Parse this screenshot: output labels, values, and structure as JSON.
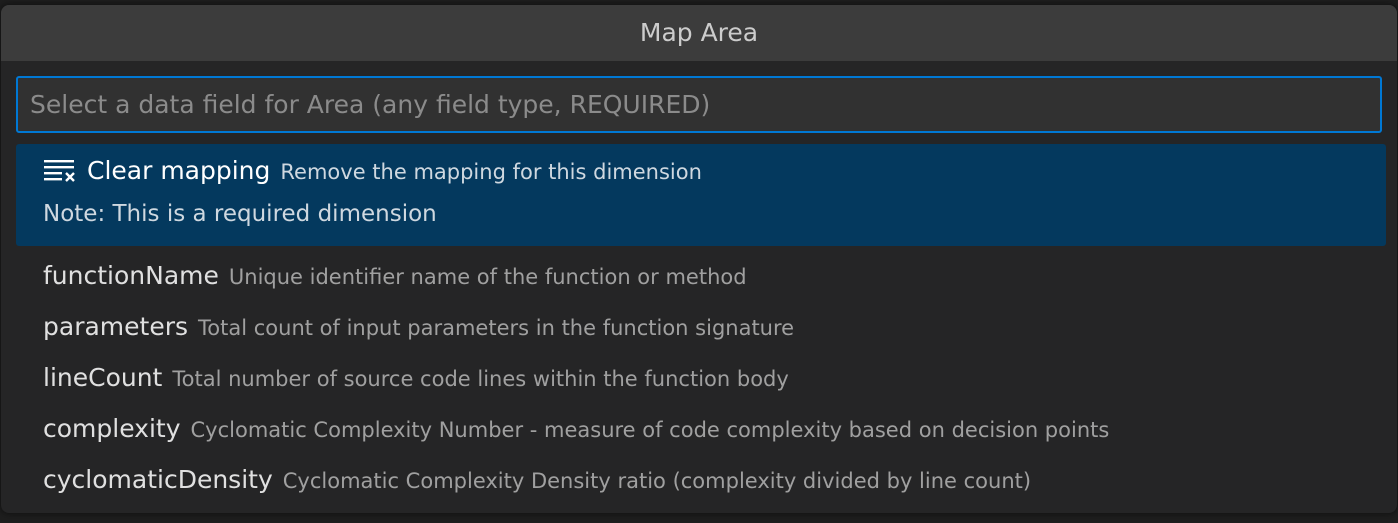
{
  "quick_pick": {
    "title": "Map Area",
    "input": {
      "value": "",
      "placeholder": "Select a data field for Area (any field type, REQUIRED)"
    },
    "clear_item": {
      "icon": "clear-all-icon",
      "label": "Clear mapping",
      "description": "Remove the mapping for this dimension",
      "detail": "Note: This is a required dimension"
    },
    "items": [
      {
        "label": "functionName",
        "description": "Unique identifier name of the function or method"
      },
      {
        "label": "parameters",
        "description": "Total count of input parameters in the function signature"
      },
      {
        "label": "lineCount",
        "description": "Total number of source code lines within the function body"
      },
      {
        "label": "complexity",
        "description": "Cyclomatic Complexity Number - measure of code complexity based on decision points"
      },
      {
        "label": "cyclomaticDensity",
        "description": "Cyclomatic Complexity Density ratio (complexity divided by line count)"
      }
    ]
  },
  "colors": {
    "accent": "#0078d4",
    "selected_background": "#04395e",
    "panel_background": "#252526",
    "title_background": "#3c3c3c"
  }
}
